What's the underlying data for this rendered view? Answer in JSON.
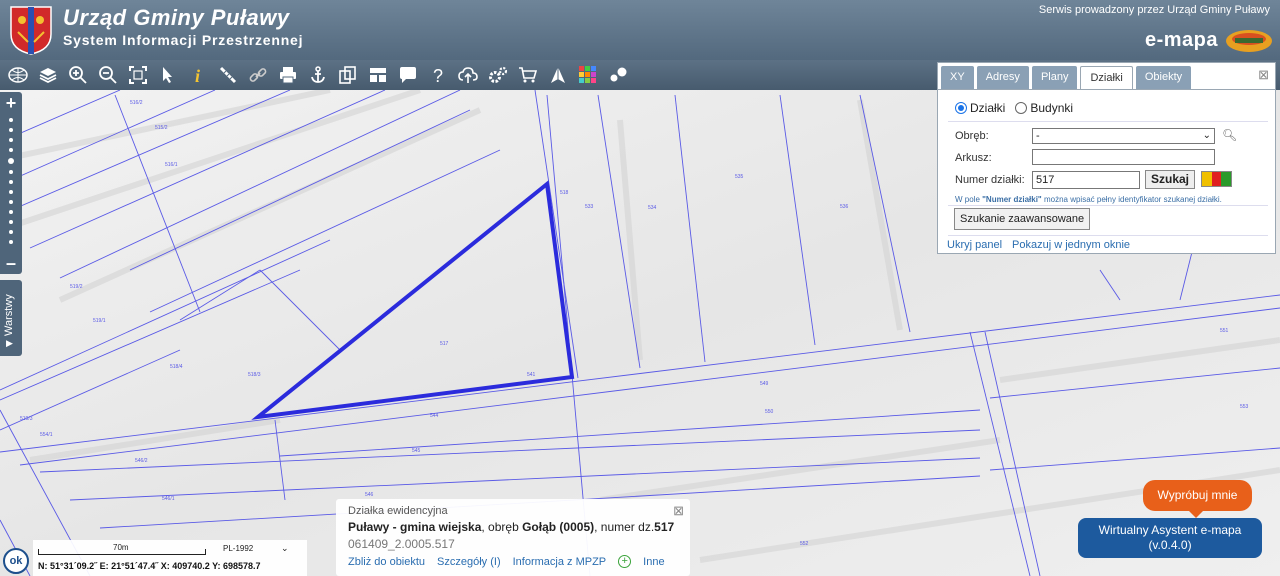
{
  "header": {
    "title": "Urząd Gminy Puławy",
    "subtitle": "System Informacji Przestrzennej",
    "served_by": "Serwis prowadzony przez Urząd Gminy Puławy",
    "brand": "e-mapa"
  },
  "toolbar": {
    "tools": [
      "globe-icon",
      "layers-icon",
      "zoom-in-icon",
      "zoom-out-icon",
      "zoom-extent-icon",
      "pointer-icon",
      "info-icon",
      "measure-icon",
      "link-icon",
      "print-icon",
      "anchor-icon",
      "copy-icon",
      "layout-icon",
      "comment-icon",
      "help-icon",
      "upload-icon",
      "settings-icon",
      "cart-icon",
      "north-icon",
      "grid-icon",
      "points-icon"
    ]
  },
  "sidebar": {
    "layers_label": "Warstwy"
  },
  "search_panel": {
    "tabs": [
      {
        "label": "XY",
        "active": false
      },
      {
        "label": "Adresy",
        "active": false
      },
      {
        "label": "Plany",
        "active": false
      },
      {
        "label": "Działki",
        "active": true
      },
      {
        "label": "Obiekty",
        "active": false
      }
    ],
    "radio_dzialki": "Działki",
    "radio_budynki": "Budynki",
    "obreb_label": "Obręb:",
    "obreb_value": "-",
    "arkusz_label": "Arkusz:",
    "arkusz_value": "",
    "numer_label": "Numer działki:",
    "numer_value": "517",
    "search_button": "Szukaj",
    "hint_prefix": "W pole ",
    "hint_bold": "\"Numer działki\"",
    "hint_suffix": " można wpisać pełny identyfikator szukanej działki.",
    "advanced_button": "Szukanie zaawansowane",
    "hide_panel": "Ukryj panel",
    "show_in_one": "Pokazuj w jednym oknie",
    "colors": [
      "#f0c000",
      "#e02020",
      "#2a9a2a"
    ]
  },
  "info_panel": {
    "title": "Działka ewidencyjna",
    "place": "Puławy - gmina wiejska",
    "obreb_text": ", obręb ",
    "obreb": "Gołąb (0005)",
    "numer_text": ", numer dz.",
    "numer": "517",
    "identifier": "061409_2.0005.517",
    "links": [
      "Zbliż do obiektu",
      "Szczegóły (I)",
      "Informacja z MPZP",
      "Inne"
    ]
  },
  "scale": {
    "label": "70m",
    "crs": "PL-1992",
    "coords": "N: 51°31´09.2˝  E: 21°51´47.4˝  X: 409740.2  Y: 698578.7",
    "ok": "ok"
  },
  "assistant": {
    "try_label": "Wypróbuj mnie",
    "name": "Wirtualny Asystent e-mapa",
    "version": "(v.0.4.0)"
  },
  "map": {
    "parcel_labels": [
      "516/2",
      "515/2",
      "516/1",
      "517",
      "518",
      "533",
      "534",
      "535",
      "536",
      "519/1",
      "518/4",
      "518/3",
      "519/2",
      "519/3",
      "541",
      "544",
      "545",
      "546/2",
      "546/1",
      "546",
      "549",
      "550",
      "551",
      "552",
      "553",
      "554/1"
    ],
    "highlight_color": "#2b2bdc"
  }
}
